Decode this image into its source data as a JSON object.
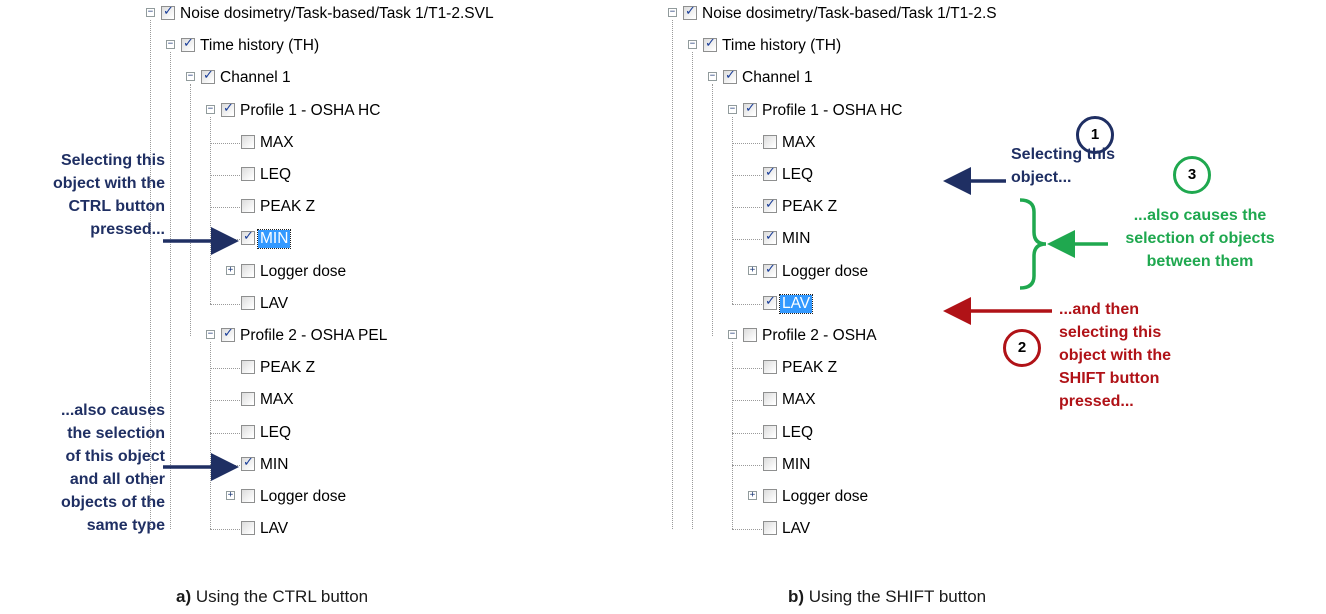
{
  "left_tree": {
    "rows": [
      {
        "label": "Noise dosimetry/Task-based/Task 1/T1-2.SVL",
        "checked": true,
        "expander": "minus"
      },
      {
        "label": "Time history (TH)",
        "checked": true,
        "expander": "minus"
      },
      {
        "label": "Channel 1",
        "checked": true,
        "expander": "minus"
      },
      {
        "label": "Profile 1 - OSHA HC",
        "checked": true,
        "expander": "minus"
      },
      {
        "label": "MAX",
        "checked": false,
        "expander": ""
      },
      {
        "label": "LEQ",
        "checked": false,
        "expander": ""
      },
      {
        "label": "PEAK Z",
        "checked": false,
        "expander": ""
      },
      {
        "label": "MIN",
        "checked": true,
        "expander": "",
        "selected": true
      },
      {
        "label": "Logger dose",
        "checked": false,
        "expander": "plus"
      },
      {
        "label": "LAV",
        "checked": false,
        "expander": ""
      },
      {
        "label": "Profile 2 - OSHA PEL",
        "checked": true,
        "expander": "minus"
      },
      {
        "label": "PEAK Z",
        "checked": false,
        "expander": ""
      },
      {
        "label": "MAX",
        "checked": false,
        "expander": ""
      },
      {
        "label": "LEQ",
        "checked": false,
        "expander": ""
      },
      {
        "label": "MIN",
        "checked": true,
        "expander": ""
      },
      {
        "label": "Logger dose",
        "checked": false,
        "expander": "plus"
      },
      {
        "label": "LAV",
        "checked": false,
        "expander": ""
      }
    ]
  },
  "right_tree": {
    "rows": [
      {
        "label": "Noise dosimetry/Task-based/Task 1/T1-2.S",
        "checked": true,
        "expander": "minus"
      },
      {
        "label": "Time history (TH)",
        "checked": true,
        "expander": "minus"
      },
      {
        "label": "Channel 1",
        "checked": true,
        "expander": "minus"
      },
      {
        "label": "Profile 1 - OSHA HC",
        "checked": true,
        "expander": "minus"
      },
      {
        "label": "MAX",
        "checked": false,
        "expander": ""
      },
      {
        "label": "LEQ",
        "checked": true,
        "expander": ""
      },
      {
        "label": "PEAK Z",
        "checked": true,
        "expander": ""
      },
      {
        "label": "MIN",
        "checked": true,
        "expander": ""
      },
      {
        "label": "Logger dose",
        "checked": true,
        "expander": "plus"
      },
      {
        "label": "LAV",
        "checked": true,
        "expander": "",
        "selected": true
      },
      {
        "label": "Profile 2 - OSHA",
        "checked": false,
        "expander": "minus"
      },
      {
        "label": "PEAK Z",
        "checked": false,
        "expander": ""
      },
      {
        "label": "MAX",
        "checked": false,
        "expander": ""
      },
      {
        "label": "LEQ",
        "checked": false,
        "expander": ""
      },
      {
        "label": "MIN",
        "checked": false,
        "expander": ""
      },
      {
        "label": "Logger dose",
        "checked": false,
        "expander": "plus"
      },
      {
        "label": "LAV",
        "checked": false,
        "expander": ""
      }
    ]
  },
  "annotations": {
    "left_top": [
      "Selecting this",
      "object with the",
      "CTRL button",
      "pressed..."
    ],
    "left_bottom": [
      "...also causes",
      "the selection",
      "of this object",
      "and all other",
      "objects of the",
      "same type"
    ],
    "right_step1": [
      "Selecting this",
      "object..."
    ],
    "right_step3": [
      "...also causes the",
      "selection of objects",
      "between them"
    ],
    "right_step2": [
      "...and then",
      "selecting this",
      "object with the",
      "SHIFT button",
      "pressed..."
    ],
    "badge1": "1",
    "badge2": "2",
    "badge3": "3"
  },
  "captions": {
    "a_letter": "a)",
    "a_text": " Using the CTRL button",
    "b_letter": "b)",
    "b_text": " Using the SHIFT button"
  },
  "colors": {
    "navy": "#1f2f63",
    "green": "#1fa84f",
    "red": "#b01217",
    "selection": "#3399ff"
  }
}
